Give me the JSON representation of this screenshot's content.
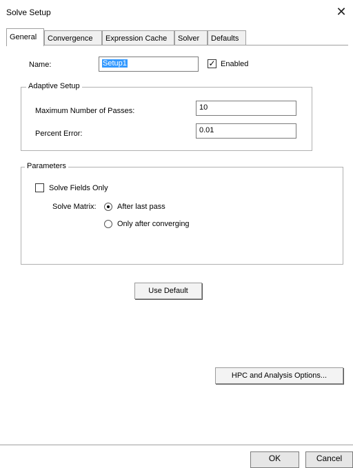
{
  "window": {
    "title": "Solve Setup",
    "close_glyph": "✕"
  },
  "tabs": [
    {
      "label": "General",
      "active": true
    },
    {
      "label": "Convergence",
      "active": false
    },
    {
      "label": "Expression Cache",
      "active": false
    },
    {
      "label": "Solver",
      "active": false
    },
    {
      "label": "Defaults",
      "active": false
    }
  ],
  "general": {
    "name_label": "Name:",
    "name_value": "Setup1",
    "enabled_label": "Enabled",
    "enabled_checked": true,
    "adaptive": {
      "title": "Adaptive Setup",
      "max_passes_label": "Maximum Number of Passes:",
      "max_passes_value": "10",
      "percent_error_label": "Percent Error:",
      "percent_error_value": "0.01"
    },
    "parameters": {
      "title": "Parameters",
      "solve_fields_only_label": "Solve Fields Only",
      "solve_fields_only_checked": false,
      "solve_matrix_label": "Solve Matrix:",
      "options": [
        {
          "label": "After last pass",
          "selected": true
        },
        {
          "label": "Only after converging",
          "selected": false
        }
      ]
    },
    "use_default_label": "Use Default",
    "hpc_label": "HPC and Analysis Options..."
  },
  "footer": {
    "ok_label": "OK",
    "cancel_label": "Cancel"
  }
}
